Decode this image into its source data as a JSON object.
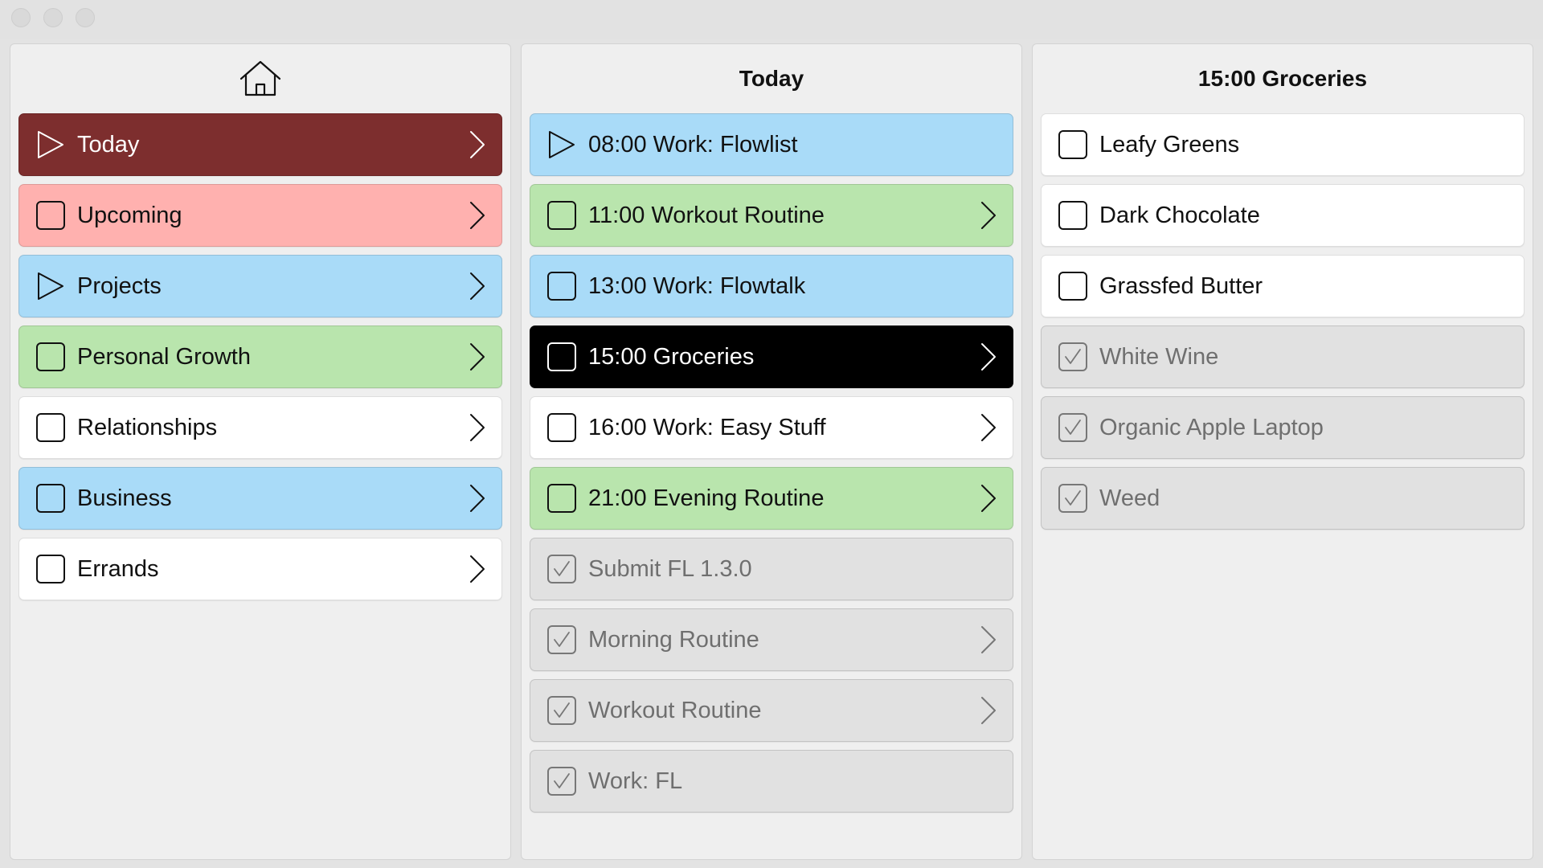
{
  "colors": {
    "white": "#ffffff",
    "red": "#ffb1af",
    "blue": "#a9dbf8",
    "green": "#b9e5ad",
    "maroon": "#7d2e2e",
    "black": "#000000",
    "done": "#e1e1e1"
  },
  "columns": [
    {
      "header_icon": "home-icon",
      "title": "",
      "items": [
        {
          "label": "Today",
          "color": "maroon",
          "marker": "play-icon",
          "chevron": true
        },
        {
          "label": "Upcoming",
          "color": "red",
          "marker": "checkbox-icon",
          "chevron": true
        },
        {
          "label": "Projects",
          "color": "blue",
          "marker": "play-icon",
          "chevron": true
        },
        {
          "label": "Personal Growth",
          "color": "green",
          "marker": "checkbox-icon",
          "chevron": true
        },
        {
          "label": "Relationships",
          "color": "white",
          "marker": "checkbox-icon",
          "chevron": true
        },
        {
          "label": "Business",
          "color": "blue",
          "marker": "checkbox-icon",
          "chevron": true
        },
        {
          "label": "Errands",
          "color": "white",
          "marker": "checkbox-icon",
          "chevron": true
        }
      ]
    },
    {
      "title": "Today",
      "items": [
        {
          "label": "08:00 Work: Flowlist",
          "color": "blue",
          "marker": "play-icon",
          "chevron": false
        },
        {
          "label": "11:00 Workout Routine",
          "color": "green",
          "marker": "checkbox-icon",
          "chevron": true
        },
        {
          "label": "13:00 Work: Flowtalk",
          "color": "blue",
          "marker": "checkbox-icon",
          "chevron": false
        },
        {
          "label": "15:00 Groceries",
          "color": "black",
          "marker": "checkbox-icon",
          "chevron": true
        },
        {
          "label": "16:00 Work: Easy Stuff",
          "color": "white",
          "marker": "checkbox-icon",
          "chevron": true
        },
        {
          "label": "21:00 Evening Routine",
          "color": "green",
          "marker": "checkbox-icon",
          "chevron": true
        },
        {
          "label": "Submit FL 1.3.0",
          "color": "done",
          "marker": "checked-icon",
          "chevron": false
        },
        {
          "label": "Morning Routine",
          "color": "done",
          "marker": "checked-icon",
          "chevron": true
        },
        {
          "label": "Workout Routine",
          "color": "done",
          "marker": "checked-icon",
          "chevron": true
        },
        {
          "label": "Work: FL",
          "color": "done",
          "marker": "checked-icon",
          "chevron": false
        }
      ]
    },
    {
      "title": "15:00 Groceries",
      "items": [
        {
          "label": "Leafy Greens",
          "color": "white",
          "marker": "checkbox-icon",
          "chevron": false
        },
        {
          "label": "Dark Chocolate",
          "color": "white",
          "marker": "checkbox-icon",
          "chevron": false
        },
        {
          "label": "Grassfed Butter",
          "color": "white",
          "marker": "checkbox-icon",
          "chevron": false
        },
        {
          "label": "White Wine",
          "color": "done",
          "marker": "checked-icon",
          "chevron": false
        },
        {
          "label": "Organic Apple Laptop",
          "color": "done",
          "marker": "checked-icon",
          "chevron": false
        },
        {
          "label": "Weed",
          "color": "done",
          "marker": "checked-icon",
          "chevron": false
        }
      ]
    }
  ]
}
